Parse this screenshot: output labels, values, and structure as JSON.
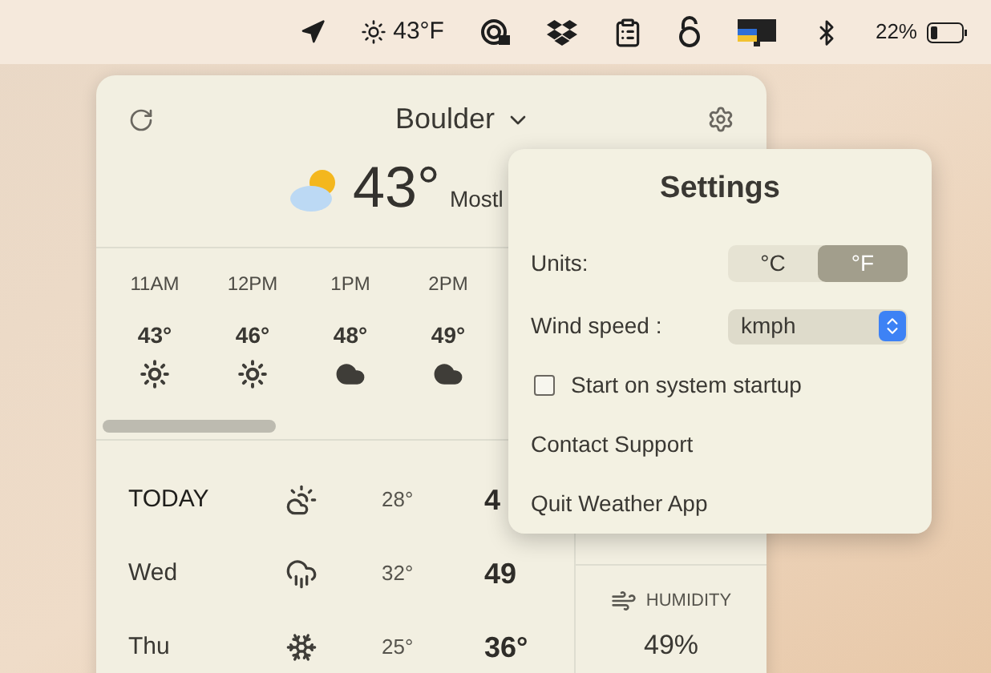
{
  "menu_bar": {
    "weather": "43°F",
    "battery": "22%"
  },
  "weather_panel": {
    "location": "Boulder",
    "current": {
      "temperature": "43°",
      "condition": "Mostl"
    },
    "hourly": [
      {
        "time": "11AM",
        "temperature": "43°",
        "kind": "sun"
      },
      {
        "time": "12PM",
        "temperature": "46°",
        "kind": "sun"
      },
      {
        "time": "1PM",
        "temperature": "48°",
        "kind": "cloud"
      },
      {
        "time": "2PM",
        "temperature": "49°",
        "kind": "cloud"
      }
    ],
    "daily": [
      {
        "day": "TODAY",
        "kind": "partly-cloudy",
        "low": "28°",
        "high": "4"
      },
      {
        "day": "Wed",
        "kind": "rain",
        "low": "32°",
        "high": "49"
      },
      {
        "day": "Thu",
        "kind": "snow",
        "low": "25°",
        "high": "36°"
      }
    ],
    "humidity": {
      "label": "HUMIDITY",
      "value": "49%"
    }
  },
  "settings": {
    "title": "Settings",
    "units": {
      "label": "Units:",
      "options": [
        {
          "label": "°C",
          "selected": false
        },
        {
          "label": "°F",
          "selected": true
        }
      ]
    },
    "wind_speed": {
      "label": "Wind speed :",
      "value": "kmph"
    },
    "startup": {
      "label": "Start on system startup",
      "checked": false
    },
    "links": [
      "Contact Support",
      "Quit Weather App"
    ]
  }
}
